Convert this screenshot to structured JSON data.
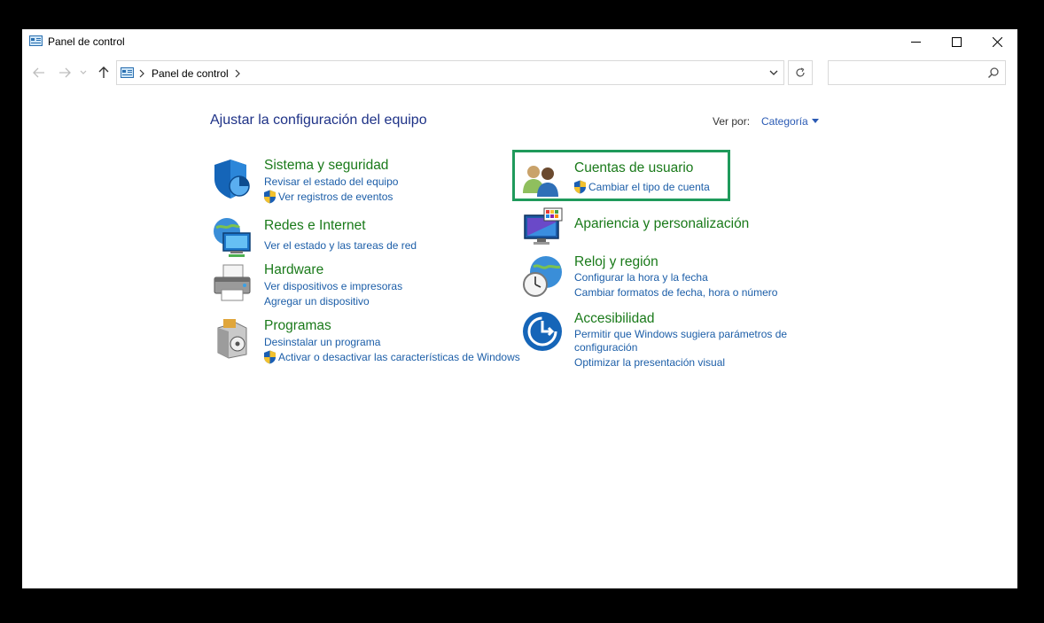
{
  "window": {
    "title": "Panel de control"
  },
  "address": {
    "crumb": "Panel de control",
    "search_placeholder": ""
  },
  "main": {
    "heading": "Ajustar la configuración del equipo",
    "view_by_label": "Ver por:",
    "view_by_value": "Categoría"
  },
  "categories": {
    "sistema": {
      "title": "Sistema y seguridad",
      "links": [
        "Revisar el estado del equipo",
        "Ver registros de eventos"
      ]
    },
    "redes": {
      "title": "Redes e Internet",
      "links": [
        "Ver el estado y las tareas de red"
      ]
    },
    "hardware": {
      "title": "Hardware",
      "links": [
        "Ver dispositivos e impresoras",
        "Agregar un dispositivo"
      ]
    },
    "programas": {
      "title": "Programas",
      "links": [
        "Desinstalar un programa",
        "Activar o desactivar las características de Windows"
      ]
    },
    "cuentas": {
      "title": "Cuentas de usuario",
      "links": [
        "Cambiar el tipo de cuenta"
      ]
    },
    "apariencia": {
      "title": "Apariencia y personalización"
    },
    "reloj": {
      "title": "Reloj y región",
      "links": [
        "Configurar la hora y la fecha",
        "Cambiar formatos de fecha, hora o número"
      ]
    },
    "accesibilidad": {
      "title": "Accesibilidad",
      "links": [
        "Permitir que Windows sugiera parámetros de",
        "configuración",
        "Optimizar la presentación visual"
      ]
    }
  },
  "colors": {
    "link": "#1c5ea8",
    "category_title": "#1a7a1a",
    "heading": "#1e3287",
    "highlight": "#1f9a5b"
  }
}
